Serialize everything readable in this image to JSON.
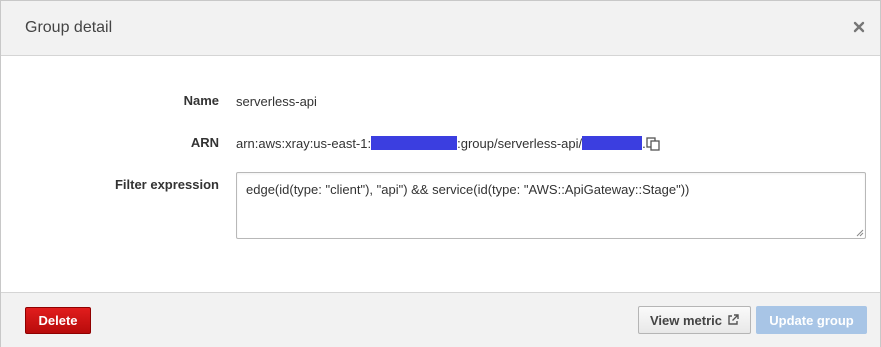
{
  "dialog": {
    "title": "Group detail"
  },
  "fields": {
    "name_label": "Name",
    "name_value": "serverless-api",
    "arn_label": "ARN",
    "arn_prefix": "arn:aws:xray:us-east-1:",
    "arn_middle": ":group/serverless-api/",
    "arn_suffix": ".",
    "filter_label": "Filter expression",
    "filter_value": "edge(id(type: \"client\"), \"api\") && service(id(type: \"AWS::ApiGateway::Stage\"))"
  },
  "footer": {
    "delete_label": "Delete",
    "view_metric_label": "View metric",
    "update_group_label": "Update group"
  },
  "icons": {
    "close": "close-icon",
    "copy": "copy-icon",
    "external_link": "external-link-icon"
  },
  "colors": {
    "delete_button": "#cc1111",
    "update_button_disabled": "#a8c5e6",
    "header_bg": "#f2f2f2",
    "redaction": "#3b3ee0"
  }
}
